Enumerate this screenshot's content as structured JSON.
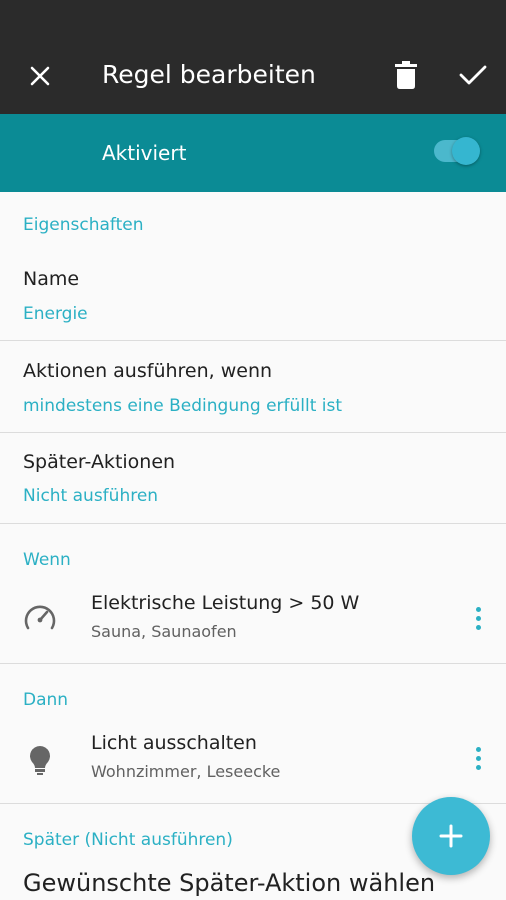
{
  "toolbar": {
    "title": "Regel bearbeiten",
    "close_icon": "close-icon",
    "delete_icon": "trash-icon",
    "confirm_icon": "check-icon"
  },
  "activation": {
    "label": "Aktiviert",
    "enabled": true
  },
  "properties": {
    "header": "Eigenschaften",
    "name_title": "Name",
    "name_value": "Energie",
    "execute_title": "Aktionen ausführen, wenn",
    "execute_value": "mindestens eine Bedingung erfüllt ist",
    "later_title": "Später-Aktionen",
    "later_value": "Nicht ausführen"
  },
  "when": {
    "header": "Wenn",
    "item_title": "Elektrische Leistung > 50 W",
    "item_sub": "Sauna, Saunaofen",
    "icon": "speedometer-icon"
  },
  "then": {
    "header": "Dann",
    "item_title": "Licht ausschalten",
    "item_sub": "Wohnzimmer, Leseecke",
    "icon": "lightbulb-icon"
  },
  "later": {
    "header": "Später (Nicht ausführen)",
    "choose_text": "Gewünschte Später-Aktion wählen"
  },
  "colors": {
    "toolbar": "#2b2b2b",
    "accent_bar": "#0b8b95",
    "accent_text": "#2bb0c4",
    "fab": "#3dbad4"
  }
}
